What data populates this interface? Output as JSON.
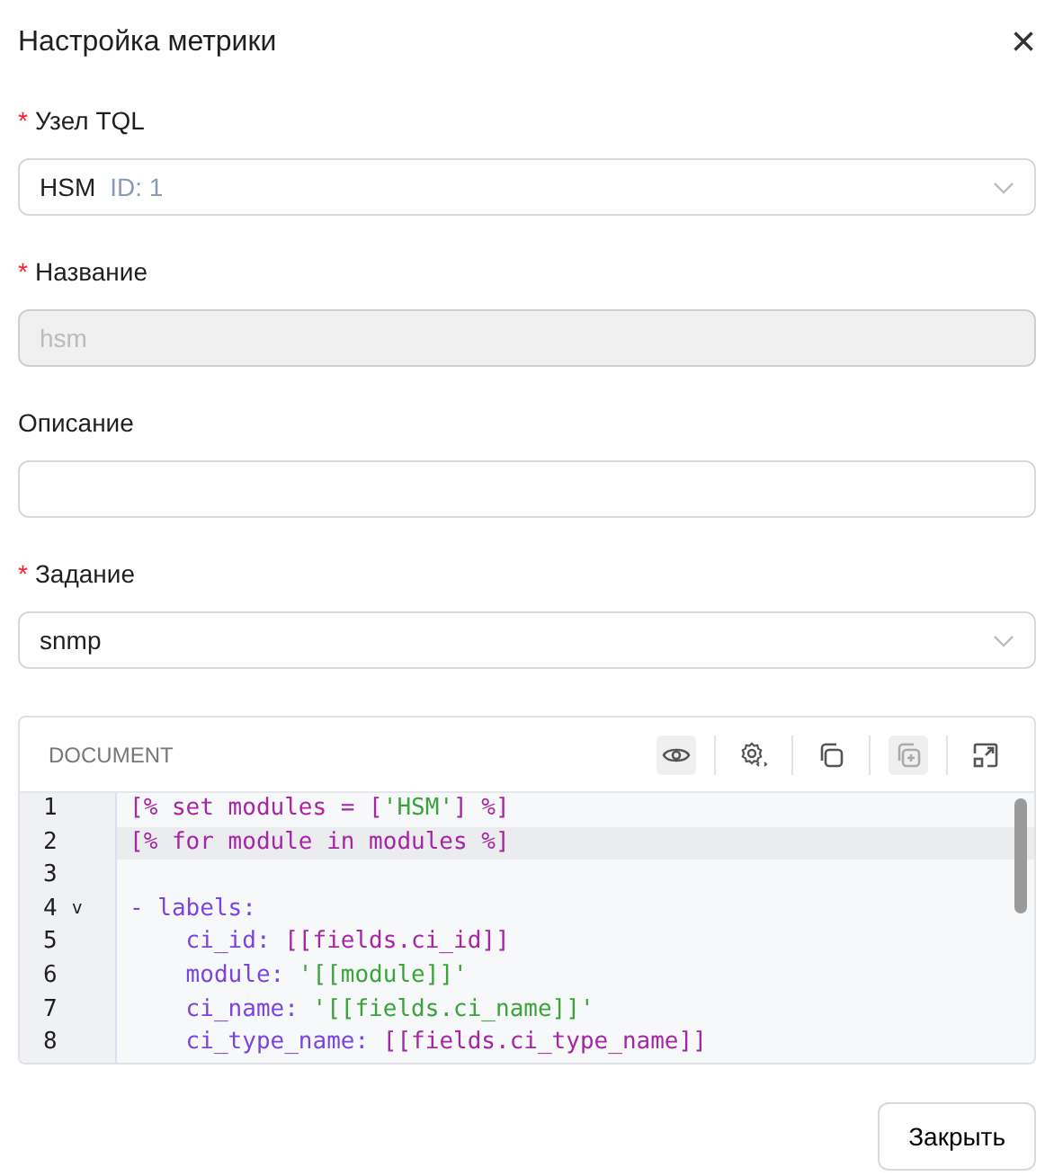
{
  "dialog": {
    "title": "Настройка метрики",
    "close": "×"
  },
  "fields": [
    {
      "kind": "select",
      "required_mark": "*",
      "label": "Узел TQL",
      "value": "HSM",
      "hint": "ID: 1",
      "disabled": false
    },
    {
      "kind": "input",
      "required_mark": "*",
      "label": "Название",
      "value": "hsm",
      "disabled": true
    },
    {
      "kind": "input",
      "label": "Описание",
      "disabled": false
    },
    {
      "kind": "select",
      "required_mark": "*",
      "label": "Задание",
      "value": "snmp",
      "disabled": false
    }
  ],
  "editor": {
    "title": "DOCUMENT",
    "tools": [
      {
        "kind": "eye",
        "active": true
      },
      {
        "kind": "gear",
        "active": false
      },
      {
        "kind": "copy",
        "active": false
      },
      {
        "kind": "add",
        "active": true
      },
      {
        "kind": "expand",
        "active": false
      }
    ],
    "lines": [
      {
        "number": "1",
        "active": false,
        "tokens": [
          {
            "kind": "tmpl",
            "text": "[% set modules = ["
          },
          {
            "kind": "str",
            "text": "'HSM'"
          },
          {
            "kind": "tmpl",
            "text": "] %]"
          }
        ]
      },
      {
        "number": "2",
        "active": true,
        "tokens": [
          {
            "kind": "tmpl",
            "text": "[% for module in modules %]"
          }
        ]
      },
      {
        "number": "3",
        "active": false
      },
      {
        "number": "4",
        "fold": "v",
        "active": false,
        "tokens": [
          {
            "kind": "key",
            "text": "- labels:"
          }
        ]
      },
      {
        "number": "5",
        "active": false,
        "tokens": [
          {
            "kind": "key",
            "text": "    ci_id: "
          },
          {
            "kind": "tmpl",
            "text": "[[fields.ci_id]]"
          }
        ]
      },
      {
        "number": "6",
        "active": false,
        "tokens": [
          {
            "kind": "key",
            "text": "    module: "
          },
          {
            "kind": "str",
            "text": "'[[module]]'"
          }
        ]
      },
      {
        "number": "7",
        "active": false,
        "tokens": [
          {
            "kind": "key",
            "text": "    ci_name: "
          },
          {
            "kind": "str",
            "text": "'[[fields.ci_name]]'"
          }
        ]
      },
      {
        "number": "8",
        "active": false,
        "tokens": [
          {
            "kind": "key",
            "text": "    ci_type_name: "
          },
          {
            "kind": "tmpl",
            "text": "[[fields.ci_type_name]]"
          }
        ]
      }
    ]
  },
  "buttons": [
    "Закрыть"
  ]
}
